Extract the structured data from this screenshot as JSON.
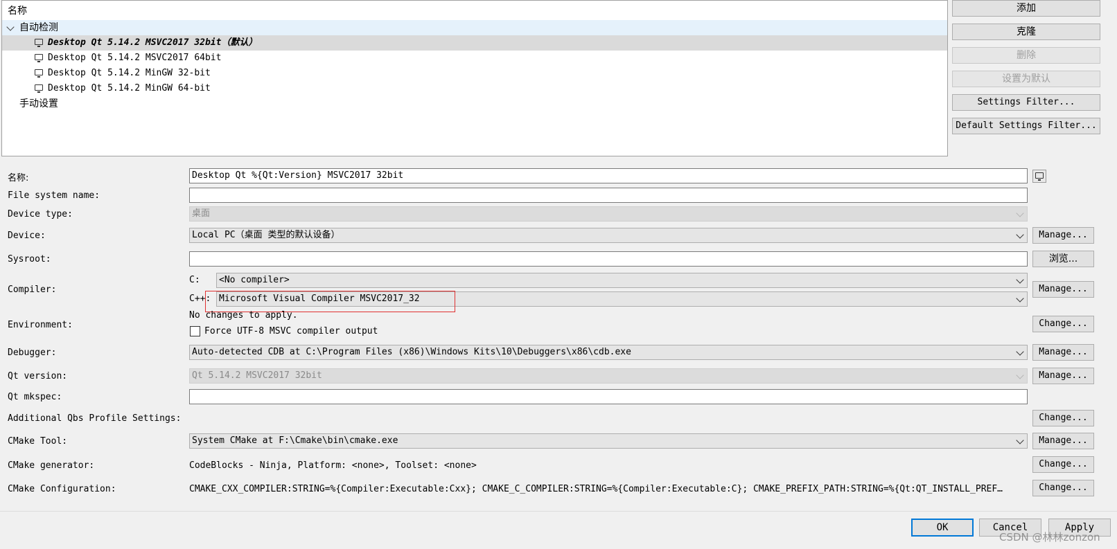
{
  "tree": {
    "header": "名称",
    "group_auto": "自动检测",
    "kits": [
      {
        "label": "Desktop Qt 5.14.2 MSVC2017 32bit（默认）",
        "selected": true
      },
      {
        "label": "Desktop Qt 5.14.2 MSVC2017 64bit",
        "selected": false
      },
      {
        "label": "Desktop Qt 5.14.2 MinGW 32-bit",
        "selected": false
      },
      {
        "label": "Desktop Qt 5.14.2 MinGW 64-bit",
        "selected": false
      }
    ],
    "group_manual": "手动设置"
  },
  "side_buttons": {
    "add": "添加",
    "clone": "克隆",
    "remove": "删除",
    "make_default": "设置为默认",
    "settings_filter": "Settings Filter...",
    "default_settings_filter": "Default Settings Filter..."
  },
  "form": {
    "name": {
      "label": "名称:",
      "value": "Desktop Qt %{Qt:Version} MSVC2017 32bit"
    },
    "fs_name": {
      "label": "File system name:",
      "value": ""
    },
    "device_type": {
      "label": "Device type:",
      "value": "桌面"
    },
    "device": {
      "label": "Device:",
      "value": "Local PC（桌面 类型的默认设备）",
      "button": "Manage..."
    },
    "sysroot": {
      "label": "Sysroot:",
      "value": "",
      "button": "浏览..."
    },
    "compiler": {
      "label": "Compiler:",
      "c_label": "C:",
      "c_value": "<No compiler>",
      "cpp_label": "C++:",
      "cpp_value": "Microsoft Visual Compiler MSVC2017_32",
      "button": "Manage..."
    },
    "environment": {
      "label": "Environment:",
      "status": "No changes to apply.",
      "checkbox_label": "Force UTF-8 MSVC compiler output",
      "checkbox_checked": false,
      "button": "Change..."
    },
    "debugger": {
      "label": "Debugger:",
      "value": "Auto-detected CDB at C:\\Program Files (x86)\\Windows Kits\\10\\Debuggers\\x86\\cdb.exe",
      "button": "Manage..."
    },
    "qt_version": {
      "label": "Qt version:",
      "value": "Qt 5.14.2 MSVC2017 32bit",
      "button": "Manage..."
    },
    "qt_mkspec": {
      "label": "Qt mkspec:",
      "value": ""
    },
    "qbs": {
      "label": "Additional Qbs Profile Settings:",
      "button": "Change..."
    },
    "cmake_tool": {
      "label": "CMake Tool:",
      "value": "System CMake at F:\\Cmake\\bin\\cmake.exe",
      "button": "Manage..."
    },
    "cmake_generator": {
      "label": "CMake generator:",
      "value": "CodeBlocks - Ninja, Platform: <none>, Toolset: <none>",
      "button": "Change..."
    },
    "cmake_config": {
      "label": "CMake Configuration:",
      "value": "CMAKE_CXX_COMPILER:STRING=%{Compiler:Executable:Cxx}; CMAKE_C_COMPILER:STRING=%{Compiler:Executable:C}; CMAKE_PREFIX_PATH:STRING=%{Qt:QT_INSTALL_PREF…",
      "button": "Change..."
    }
  },
  "dialog": {
    "ok": "OK",
    "cancel": "Cancel",
    "apply": "Apply"
  },
  "watermark": "CSDN @林林zonzon",
  "colors": {
    "highlight_box": "#e03030",
    "selection_bg": "#dadada",
    "group_hover_bg": "#e5f1fb",
    "default_button_border": "#0078d7"
  }
}
